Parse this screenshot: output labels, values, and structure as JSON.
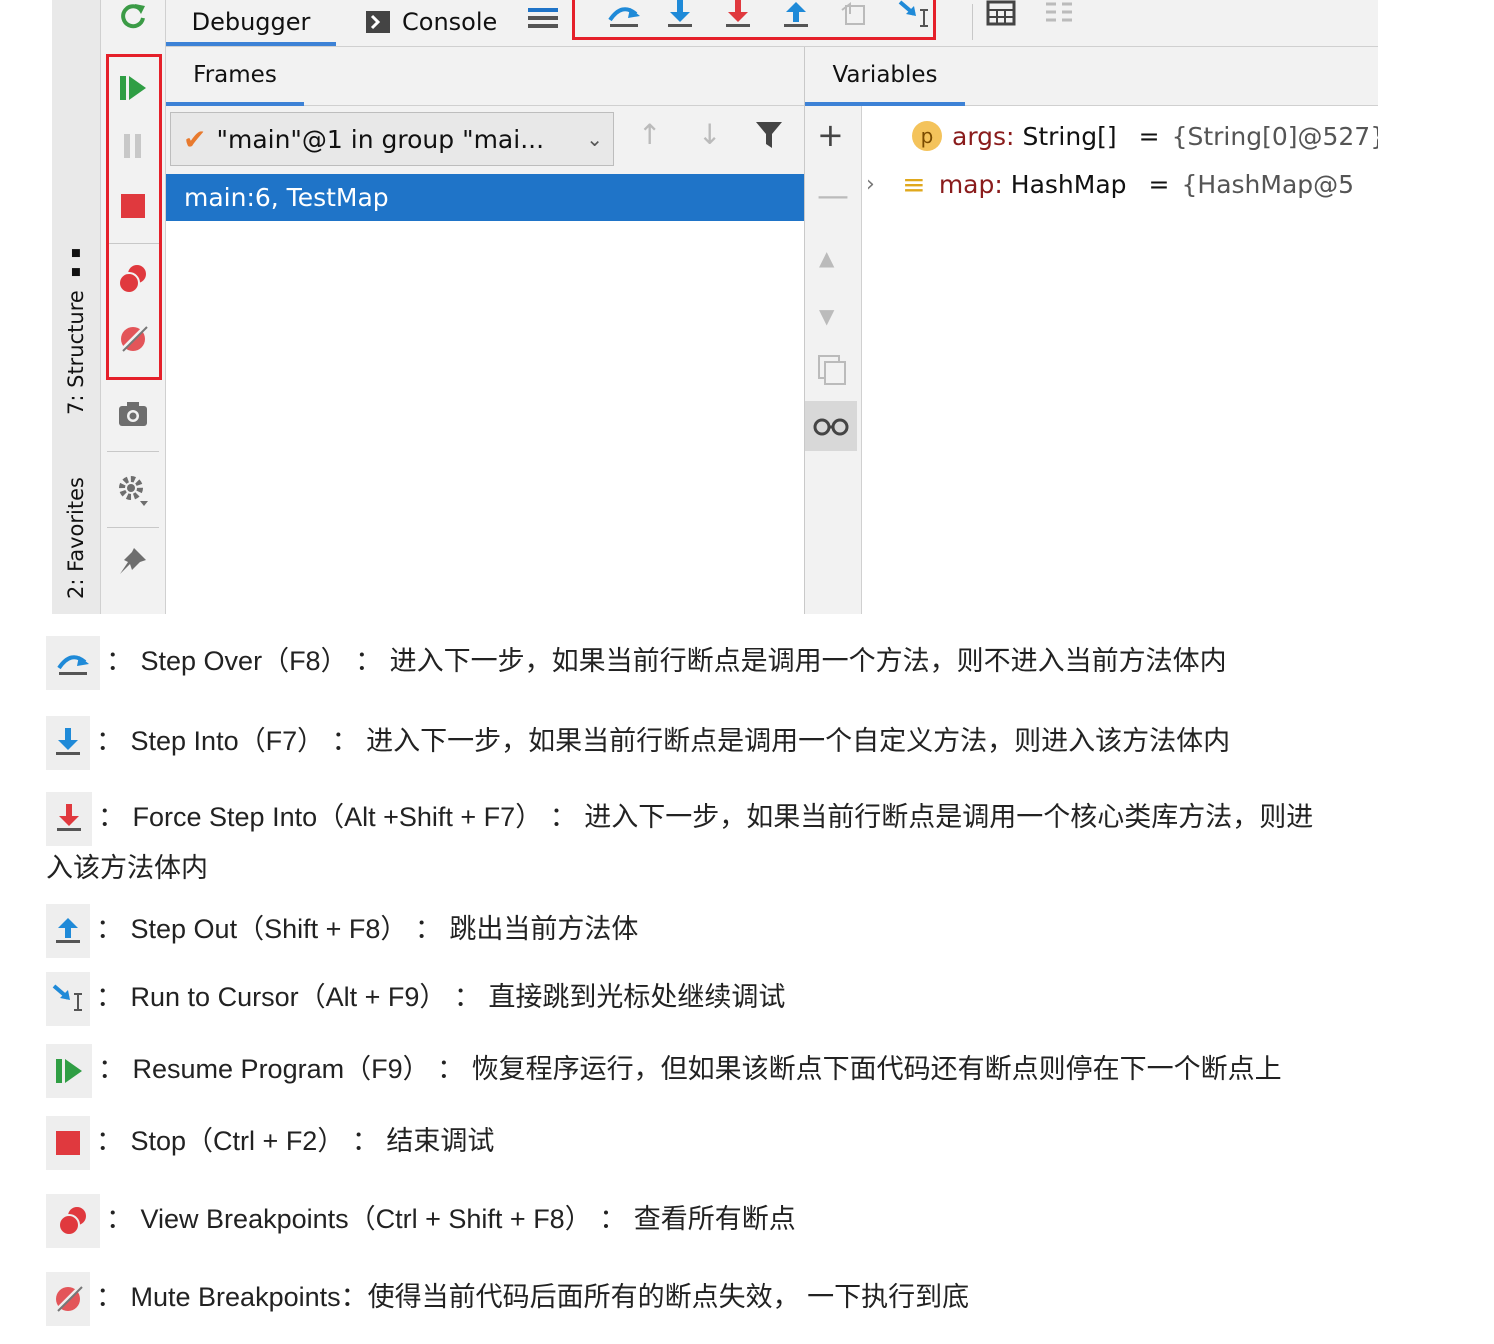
{
  "ide": {
    "side_tabs": {
      "structure": "7: Structure",
      "favorites": "2: Favorites"
    },
    "tabs": {
      "debugger": "Debugger",
      "console": "Console"
    },
    "frames": {
      "header": "Frames",
      "thread": "\"main\"@1 in group \"mai...",
      "frame": "main:6, TestMap"
    },
    "variables": {
      "header": "Variables",
      "items": [
        {
          "badge": "p",
          "name": "args:",
          "type": "String[]",
          "eq": "=",
          "value": "{String[0]@527}"
        },
        {
          "badge": "≡",
          "name": "map:",
          "type": "HashMap",
          "eq": "=",
          "value": "{HashMap@5"
        }
      ]
    }
  },
  "descriptions": [
    {
      "name": "Step Over（F8）",
      "sep": "：",
      "text": "进入下一步，如果当前行断点是调用一个方法，则不进入当前方法体内"
    },
    {
      "name": "Step Into（F7）",
      "sep": "：",
      "text": "进入下一步，如果当前行断点是调用一个自定义方法，则进入该方法体内"
    },
    {
      "name": "Force Step Into（Alt +Shift + F7）",
      "sep": "：",
      "text": "进入下一步，如果当前行断点是调用一个核心类库方法，则进",
      "text2": "入该方法体内"
    },
    {
      "name": "Step Out（Shift + F8）",
      "sep": "：",
      "text": "跳出当前方法体"
    },
    {
      "name": "Run to Cursor（Alt + F9）",
      "sep": "：",
      "text": "直接跳到光标处继续调试"
    },
    {
      "name": "Resume Program（F9）",
      "sep": "：",
      "text": "恢复程序运行，但如果该断点下面代码还有断点则停在下一个断点上"
    },
    {
      "name": "Stop（Ctrl + F2）",
      "sep": "：",
      "text": "结束调试"
    },
    {
      "name": "View Breakpoints（Ctrl + Shift + F8）",
      "sep": "：",
      "text": "查看所有断点"
    },
    {
      "name": "Mute Breakpoints：使得当前代码后面所有的断点失效，",
      "sep": "",
      "text": "一下执行到底"
    }
  ],
  "colors": {
    "accent_blue": "#1f74c8",
    "highlight_red": "#e5202a",
    "resume_green": "#2f9e44",
    "stop_red": "#e0393e"
  }
}
